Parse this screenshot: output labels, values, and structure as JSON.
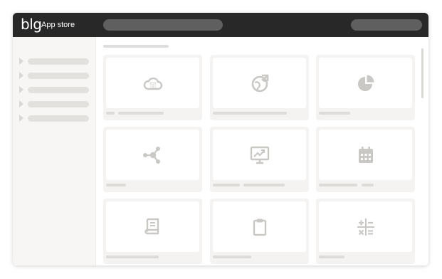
{
  "header": {
    "logo": "blg",
    "title": "App store"
  },
  "sidebar": {
    "items": [
      {
        "icon": "chevron-right-icon"
      },
      {
        "icon": "chevron-right-icon"
      },
      {
        "icon": "chevron-right-icon"
      },
      {
        "icon": "chevron-right-icon"
      },
      {
        "icon": "chevron-right-icon"
      }
    ]
  },
  "cards": [
    {
      "icon": "cloud-data-icon"
    },
    {
      "icon": "globe-arrow-icon"
    },
    {
      "icon": "pie-chart-icon"
    },
    {
      "icon": "network-hub-icon"
    },
    {
      "icon": "monitor-chart-icon"
    },
    {
      "icon": "calendar-icon"
    },
    {
      "icon": "book-icon"
    },
    {
      "icon": "clipboard-icon"
    },
    {
      "icon": "calculator-icon"
    }
  ],
  "colors": {
    "topbar": "#282828",
    "placeholder": "#dcdbd8",
    "icon": "#c9c8c5",
    "card_background": "#f4f3f1"
  }
}
